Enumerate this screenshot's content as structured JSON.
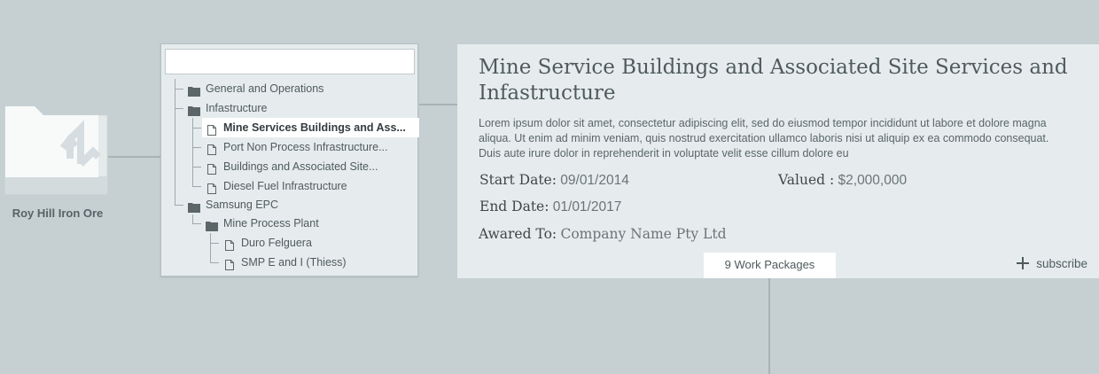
{
  "root": {
    "label": "Roy Hill Iron Ore",
    "icon": "folder-icon",
    "logo_icon": "logo-arrow-icon"
  },
  "tree": {
    "search_placeholder": "",
    "folder_icon": "folder-icon",
    "file_icon": "file-icon",
    "items": [
      {
        "label": "General and Operations",
        "type": "folder",
        "level": 0
      },
      {
        "label": "Infastructure",
        "type": "folder",
        "level": 0
      },
      {
        "label": "Mine Services Buildings and Ass...",
        "type": "file",
        "level": 1,
        "selected": true
      },
      {
        "label": "Port Non Process Infrastructure...",
        "type": "file",
        "level": 1
      },
      {
        "label": "Buildings and Associated Site...",
        "type": "file",
        "level": 1
      },
      {
        "label": "Diesel Fuel Infrastructure",
        "type": "file",
        "level": 1
      },
      {
        "label": "Samsung EPC",
        "type": "folder",
        "level": 0
      },
      {
        "label": "Mine Process Plant",
        "type": "folder",
        "level": 1
      },
      {
        "label": "Duro Felguera",
        "type": "file",
        "level": 2
      },
      {
        "label": "SMP E and I (Thiess)",
        "type": "file",
        "level": 2
      }
    ]
  },
  "detail": {
    "title": "Mine Service Buildings and Associated Site Services and Infastructure",
    "description": "Lorem ipsum dolor sit amet, consectetur adipiscing elit, sed do eiusmod tempor incididunt ut labore et dolore magna aliqua. Ut enim ad minim veniam, quis nostrud exercitation ullamco laboris nisi ut aliquip ex ea commodo consequat. Duis aute irure dolor in reprehenderit in voluptate velit esse cillum dolore eu",
    "start_date_label": "Start Date:",
    "start_date": "09/01/2014",
    "end_date_label": "End Date:",
    "end_date": "01/01/2017",
    "awarded_label": "Awared To:",
    "awarded_to": "Company Name Pty Ltd",
    "valued_label": "Valued :",
    "valued": "$2,000,000",
    "work_packages_tab": "9 Work Packages",
    "subscribe_label": "subscribe",
    "subscribe_icon": "plus-icon"
  },
  "colors": {
    "background": "#c6cfd1",
    "panel": "#e6ecee",
    "text": "#4f5a5c",
    "connector": "#a9b3b5"
  }
}
